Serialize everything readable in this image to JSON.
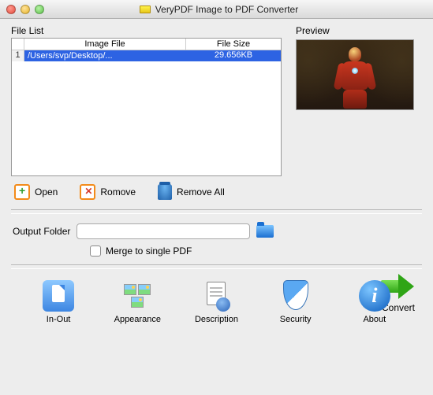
{
  "window": {
    "title": "VeryPDF Image to PDF Converter"
  },
  "file_list": {
    "label": "File List",
    "columns": {
      "index": "",
      "file": "Image File",
      "size": "File Size"
    },
    "rows": [
      {
        "index": "1",
        "file": "/Users/svp/Desktop/...",
        "size": "29.656KB"
      }
    ]
  },
  "preview": {
    "label": "Preview",
    "image_description": "Iron Man suit character standing in a dim amber hall"
  },
  "actions": {
    "open": "Open",
    "remove": "Romove",
    "remove_all": "Remove All"
  },
  "output": {
    "label": "Output Folder",
    "value": "",
    "placeholder": ""
  },
  "merge": {
    "label": "Merge to single PDF",
    "checked": false
  },
  "convert": {
    "label": "Convert"
  },
  "tabs": {
    "inout": "In-Out",
    "appearance": "Appearance",
    "description": "Description",
    "security": "Security",
    "about": "About"
  },
  "colors": {
    "selection": "#2d63e3",
    "accent_green": "#2fa516",
    "accent_blue": "#1a6fd1"
  }
}
